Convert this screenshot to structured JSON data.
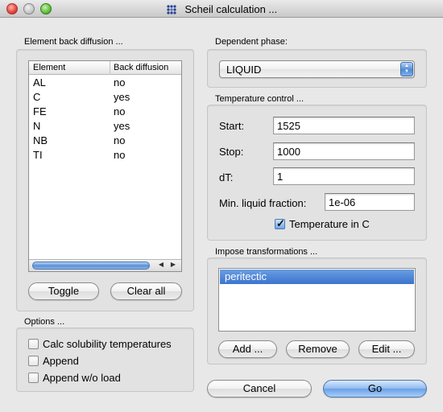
{
  "window": {
    "title": "Scheil calculation ..."
  },
  "element_diffusion": {
    "group_label": "Element back diffusion ...",
    "columns": [
      "Element",
      "Back diffusion"
    ],
    "rows": [
      {
        "element": "AL",
        "back_diffusion": "no"
      },
      {
        "element": "C",
        "back_diffusion": "yes"
      },
      {
        "element": "FE",
        "back_diffusion": "no"
      },
      {
        "element": "N",
        "back_diffusion": "yes"
      },
      {
        "element": "NB",
        "back_diffusion": "no"
      },
      {
        "element": "TI",
        "back_diffusion": "no"
      }
    ],
    "toggle_label": "Toggle",
    "clear_all_label": "Clear all"
  },
  "options": {
    "group_label": "Options ...",
    "items": [
      {
        "label": "Calc solubility temperatures",
        "checked": false
      },
      {
        "label": "Append",
        "checked": false
      },
      {
        "label": "Append w/o load",
        "checked": false
      }
    ]
  },
  "dependent_phase": {
    "group_label": "Dependent phase:",
    "selected": "LIQUID"
  },
  "temperature_control": {
    "group_label": "Temperature control ...",
    "start_label": "Start:",
    "start_value": "1525",
    "stop_label": "Stop:",
    "stop_value": "1000",
    "dt_label": "dT:",
    "dt_value": "1",
    "min_liquid_label": "Min. liquid fraction:",
    "min_liquid_value": "1e-06",
    "temp_in_c_label": "Temperature in C",
    "temp_in_c_checked": true
  },
  "transformations": {
    "group_label": "Impose transformations ...",
    "items": [
      "peritectic"
    ],
    "add_label": "Add ...",
    "remove_label": "Remove",
    "edit_label": "Edit ..."
  },
  "footer": {
    "cancel_label": "Cancel",
    "go_label": "Go"
  },
  "icons": {
    "app": "grid-dots-icon",
    "close": "close-window-icon",
    "minimize": "minimize-window-icon",
    "zoom": "zoom-window-icon",
    "scroll_left": "arrow-left-icon",
    "scroll_right": "arrow-right-icon",
    "select_arrows": "up-down-arrows-icon",
    "checkmark": "checkmark-icon"
  },
  "colors": {
    "accent": "#3b74cf",
    "window_bg": "#e8e8e8",
    "close": "#e0443a",
    "zoom": "#5fbf3b"
  }
}
